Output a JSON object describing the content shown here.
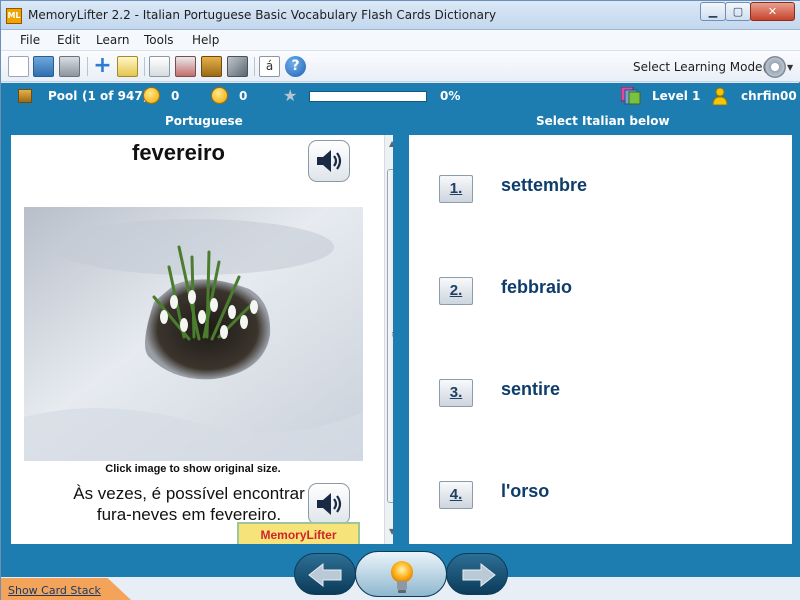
{
  "window": {
    "title": "MemoryLifter 2.2 - Italian Portuguese Basic Vocabulary Flash Cards Dictionary",
    "app_icon": "ML",
    "controls": [
      "minimize",
      "maximize",
      "close"
    ]
  },
  "menu": [
    "File",
    "Edit",
    "Learn",
    "Tools",
    "Help"
  ],
  "toolbar": {
    "icons": [
      "new-file-icon",
      "open-folder-icon",
      "print-icon",
      "add-icon",
      "edit-icon",
      "presentation-icon",
      "statistics-icon",
      "card-box-icon",
      "settings-icon",
      "special-characters-icon",
      "help-icon"
    ],
    "learning_mode_label": "Select Learning Mode(s)"
  },
  "status": {
    "pool_label": "Pool",
    "pool_count": "(1 of 947)",
    "right_count": "0",
    "wrong_count": "0",
    "progress": 0,
    "progress_text": "0%",
    "level": "Level 1",
    "user": "chrfin00"
  },
  "question": {
    "column_header": "Portuguese",
    "word": "fevereiro",
    "image_caption": "Click image to show original size.",
    "example": "Às vezes, é possível encontrar fura-neves em fevereiro.",
    "logo_text": "MemoryLifter"
  },
  "answers": {
    "column_header": "Select Italian below",
    "choices": [
      {
        "number": "1.",
        "text": "settembre"
      },
      {
        "number": "2.",
        "text": "febbraio"
      },
      {
        "number": "3.",
        "text": "sentire"
      },
      {
        "number": "4.",
        "text": "l'orso"
      }
    ]
  },
  "footer": {
    "show_card_stack": "Show Card Stack"
  },
  "colors": {
    "status_bar": "#1d7db0",
    "answer_text": "#0e3d6b",
    "progress_fill": "#3aa838"
  }
}
